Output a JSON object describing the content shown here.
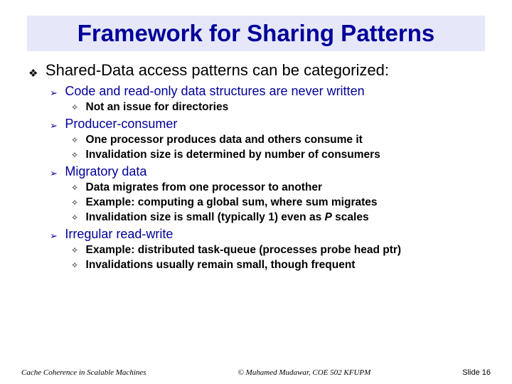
{
  "title": "Framework for Sharing Patterns",
  "b1": "Shared-Data access patterns can be categorized:",
  "s1": "Code and read-only data structures are never written",
  "s1a": "Not an issue for directories",
  "s2": "Producer-consumer",
  "s2a": "One processor produces data and others consume it",
  "s2b": "Invalidation size is determined by number of consumers",
  "s3": "Migratory data",
  "s3a": "Data migrates from one processor to another",
  "s3b": "Example: computing a global sum, where sum migrates",
  "s3c_pre": "Invalidation size is small (typically 1) even as ",
  "s3c_em": "P",
  "s3c_post": " scales",
  "s4": "Irregular read-write",
  "s4a": "Example: distributed task-queue (processes probe head ptr)",
  "s4b": "Invalidations usually remain small, though frequent",
  "footer": {
    "left": "Cache Coherence in Scalable Machines",
    "center": "© Muhamed Mudawar, COE 502 KFUPM",
    "right": "Slide 16"
  }
}
